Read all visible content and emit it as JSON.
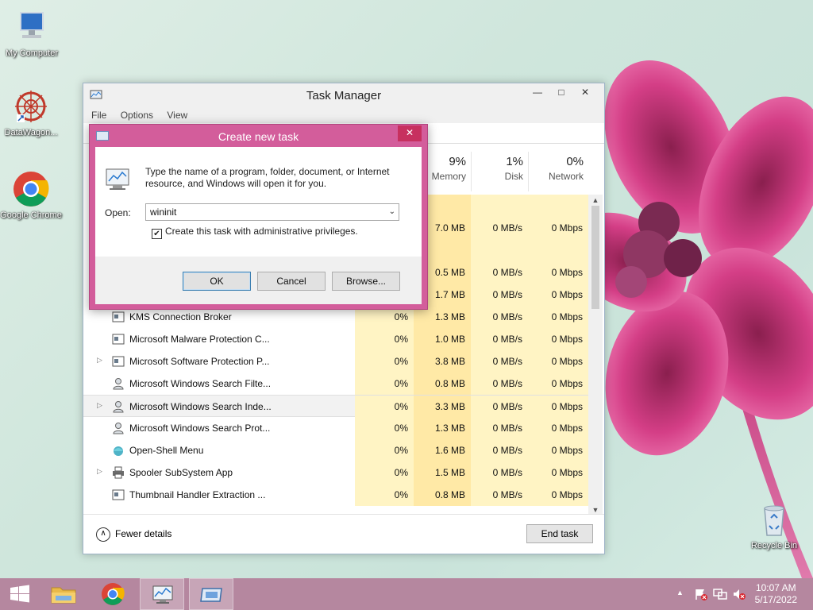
{
  "desktop": {
    "icons": [
      {
        "label": "My Computer"
      },
      {
        "label": "DataWagon..."
      },
      {
        "label": "Google Chrome"
      },
      {
        "label": "Recycle Bin"
      }
    ]
  },
  "task_manager": {
    "title": "Task Manager",
    "controls": {
      "minimize": "—",
      "maximize": "□",
      "close": "✕"
    },
    "menu": [
      "File",
      "Options",
      "View"
    ],
    "columns": {
      "memory": {
        "pct": "9%",
        "label": "Memory"
      },
      "disk": {
        "pct": "1%",
        "label": "Disk"
      },
      "network": {
        "pct": "0%",
        "label": "Network"
      }
    },
    "rows": [
      {
        "name": "",
        "cpu": "",
        "memory": "",
        "disk": "",
        "network": ""
      },
      {
        "name": "",
        "cpu": "",
        "memory": "7.0 MB",
        "disk": "0 MB/s",
        "network": "0 Mbps"
      },
      {
        "name": "",
        "cpu": "",
        "memory": "",
        "disk": "",
        "network": ""
      },
      {
        "name": "",
        "cpu": "",
        "memory": "0.5 MB",
        "disk": "0 MB/s",
        "network": "0 Mbps"
      },
      {
        "name": "",
        "cpu": "",
        "memory": "1.7 MB",
        "disk": "0 MB/s",
        "network": "0 Mbps"
      },
      {
        "name": "KMS Connection Broker",
        "cpu": "0%",
        "memory": "1.3 MB",
        "disk": "0 MB/s",
        "network": "0 Mbps"
      },
      {
        "name": "Microsoft Malware Protection C...",
        "cpu": "0%",
        "memory": "1.0 MB",
        "disk": "0 MB/s",
        "network": "0 Mbps"
      },
      {
        "name": "Microsoft Software Protection P...",
        "cpu": "0%",
        "memory": "3.8 MB",
        "disk": "0 MB/s",
        "network": "0 Mbps"
      },
      {
        "name": "Microsoft Windows Search Filte...",
        "cpu": "0%",
        "memory": "0.8 MB",
        "disk": "0 MB/s",
        "network": "0 Mbps"
      },
      {
        "name": "Microsoft Windows Search Inde...",
        "cpu": "0%",
        "memory": "3.3 MB",
        "disk": "0 MB/s",
        "network": "0 Mbps"
      },
      {
        "name": "Microsoft Windows Search Prot...",
        "cpu": "0%",
        "memory": "1.3 MB",
        "disk": "0 MB/s",
        "network": "0 Mbps"
      },
      {
        "name": "Open-Shell Menu",
        "cpu": "0%",
        "memory": "1.6 MB",
        "disk": "0 MB/s",
        "network": "0 Mbps"
      },
      {
        "name": "Spooler SubSystem App",
        "cpu": "0%",
        "memory": "1.5 MB",
        "disk": "0 MB/s",
        "network": "0 Mbps"
      },
      {
        "name": "Thumbnail Handler Extraction ...",
        "cpu": "0%",
        "memory": "0.8 MB",
        "disk": "0 MB/s",
        "network": "0 Mbps"
      }
    ],
    "footer": {
      "fewer_details": "Fewer details",
      "end_task": "End task"
    }
  },
  "dialog": {
    "title": "Create new task",
    "close": "✕",
    "description": "Type the name of a program, folder, document, or Internet resource, and Windows will open it for you.",
    "open_label": "Open:",
    "open_value": "wininit",
    "admin_checkbox": "Create this task with administrative privileges.",
    "buttons": {
      "ok": "OK",
      "cancel": "Cancel",
      "browse": "Browse..."
    }
  },
  "taskbar": {
    "time": "10:07 AM",
    "date": "5/17/2022"
  }
}
